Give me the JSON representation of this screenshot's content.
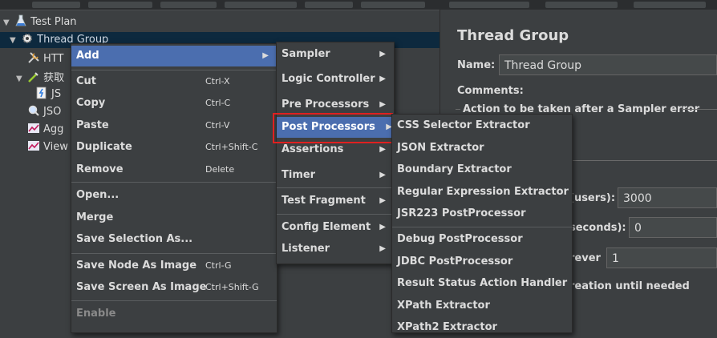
{
  "tree": {
    "items": [
      {
        "label": "Test Plan",
        "icon": "test-plan-flask-icon"
      },
      {
        "label": "Thread Group",
        "icon": "gear-icon"
      },
      {
        "label": "HTT",
        "icon": "wrench-icon"
      },
      {
        "label": "获取",
        "icon": "pipette-icon"
      },
      {
        "label": "JS",
        "icon": "script-icon"
      },
      {
        "label": "JSO",
        "icon": "magnifier-icon"
      },
      {
        "label": "Agg",
        "icon": "graph-icon"
      },
      {
        "label": "View",
        "icon": "graph-icon"
      }
    ]
  },
  "right_panel": {
    "title": "Thread Group",
    "name_label": "Name:",
    "name_value": "Thread Group",
    "comments_label": "Comments:",
    "action_label": "Action to be taken after a Sampler error",
    "users_label": "(users):",
    "users_value": "3000",
    "seconds_label": "seconds):",
    "seconds_value": "0",
    "forever_label": "rever",
    "loop_value": "1",
    "delay_label": "reation until needed"
  },
  "menu_main": {
    "items": [
      {
        "label": "Add",
        "shortcut": "",
        "submenu": true
      },
      {
        "label": "Cut",
        "shortcut": "Ctrl-X"
      },
      {
        "label": "Copy",
        "shortcut": "Ctrl-C"
      },
      {
        "label": "Paste",
        "shortcut": "Ctrl-V"
      },
      {
        "label": "Duplicate",
        "shortcut": "Ctrl+Shift-C"
      },
      {
        "label": "Remove",
        "shortcut": "Delete"
      },
      {
        "label": "Open...",
        "shortcut": ""
      },
      {
        "label": "Merge",
        "shortcut": ""
      },
      {
        "label": "Save Selection As...",
        "shortcut": ""
      },
      {
        "label": "Save Node As Image",
        "shortcut": "Ctrl-G"
      },
      {
        "label": "Save Screen As Image",
        "shortcut": "Ctrl+Shift-G"
      },
      {
        "label": "Enable",
        "shortcut": ""
      }
    ],
    "submenu_arrow": "▶"
  },
  "menu_add": {
    "items": [
      {
        "label": "Sampler"
      },
      {
        "label": "Logic Controller"
      },
      {
        "label": "Pre Processors"
      },
      {
        "label": "Post Processors"
      },
      {
        "label": "Assertions"
      },
      {
        "label": "Timer"
      },
      {
        "label": "Test Fragment"
      },
      {
        "label": "Config Element"
      },
      {
        "label": "Listener"
      }
    ],
    "arrow": "▶"
  },
  "menu_post": {
    "items": [
      {
        "label": "CSS Selector Extractor"
      },
      {
        "label": "JSON Extractor"
      },
      {
        "label": "Boundary Extractor"
      },
      {
        "label": "Regular Expression Extractor"
      },
      {
        "label": "JSR223 PostProcessor"
      },
      {
        "label": "Debug PostProcessor"
      },
      {
        "label": "JDBC PostProcessor"
      },
      {
        "label": "Result Status Action Handler"
      },
      {
        "label": "XPath Extractor"
      },
      {
        "label": "XPath2 Extractor"
      }
    ]
  },
  "colors": {
    "background": "#3c3f41",
    "selection": "#0d293e",
    "menu_active": "#4b6eaf",
    "highlight_box": "#e02020"
  }
}
